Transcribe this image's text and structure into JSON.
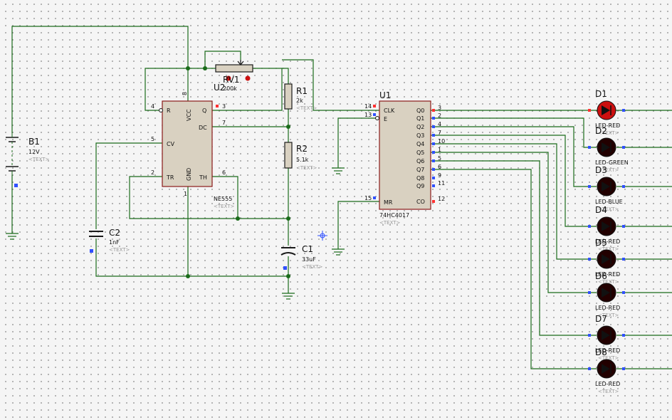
{
  "components": {
    "b1": {
      "ref": "B1",
      "value": "12V",
      "text": "<TEXT>"
    },
    "c2": {
      "ref": "C2",
      "value": "1nF",
      "text": "<TEXT>"
    },
    "c1": {
      "ref": "C1",
      "value": "33uF",
      "text": "<TEXT>"
    },
    "rv1": {
      "ref": "RV1",
      "value": "200k"
    },
    "r1": {
      "ref": "R1",
      "value": "2k",
      "text": "<TEXT>"
    },
    "r2": {
      "ref": "R2",
      "value": "5.1k",
      "text": "<TEXT>"
    },
    "u2": {
      "ref": "U2",
      "part": "NE555",
      "text": "<TEXT>",
      "pins": {
        "r": "R",
        "vcc": "VCC",
        "q": "Q",
        "dc": "DC",
        "cv": "CV",
        "tr": "TR",
        "gnd": "GND",
        "th": "TH"
      },
      "pin_numbers": {
        "n4": "4",
        "n8": "8",
        "n3": "3",
        "n7": "7",
        "n5": "5",
        "n2": "2",
        "n1": "1",
        "n6": "6"
      }
    },
    "u1": {
      "ref": "U1",
      "part": "74HC4017",
      "text": "<TEXT>",
      "left_pins": [
        {
          "num": "14",
          "name": "CLK"
        },
        {
          "num": "13",
          "name": "E"
        },
        {
          "num": "15",
          "name": "MR"
        }
      ],
      "right_pins": [
        {
          "num": "3",
          "name": "Q0"
        },
        {
          "num": "2",
          "name": "Q1"
        },
        {
          "num": "4",
          "name": "Q2"
        },
        {
          "num": "7",
          "name": "Q3"
        },
        {
          "num": "10",
          "name": "Q4"
        },
        {
          "num": "1",
          "name": "Q5"
        },
        {
          "num": "5",
          "name": "Q6"
        },
        {
          "num": "6",
          "name": "Q7"
        },
        {
          "num": "9",
          "name": "Q8"
        },
        {
          "num": "11",
          "name": "Q9"
        },
        {
          "num": "12",
          "name": "CO"
        }
      ]
    },
    "leds": [
      {
        "ref": "D1",
        "value": "LED-RED",
        "text": "<TEXT>"
      },
      {
        "ref": "D2",
        "value": "LED-GREEN",
        "text": "<TEXT>"
      },
      {
        "ref": "D3",
        "value": "LED-BLUE",
        "text": "<TEXT>"
      },
      {
        "ref": "D4",
        "value": "LED-RED",
        "text": "<TEXT>"
      },
      {
        "ref": "D5",
        "value": "LED-RED",
        "text": "<TEXT>"
      },
      {
        "ref": "D6",
        "value": "LED-RED",
        "text": "<TEXT>"
      },
      {
        "ref": "D7",
        "value": "LED-RED",
        "text": "<TEXT>"
      },
      {
        "ref": "D8",
        "value": "LED-RED",
        "text": "<TEXT>"
      }
    ]
  },
  "colors": {
    "wire": "#1a6b1a",
    "body_fill": "#d9d1c1",
    "body_stroke": "#8b1a1a",
    "led_on": "#cc1010",
    "led_off": "#220000",
    "pin_red": "#ff3030",
    "pin_blue": "#3050ff"
  }
}
